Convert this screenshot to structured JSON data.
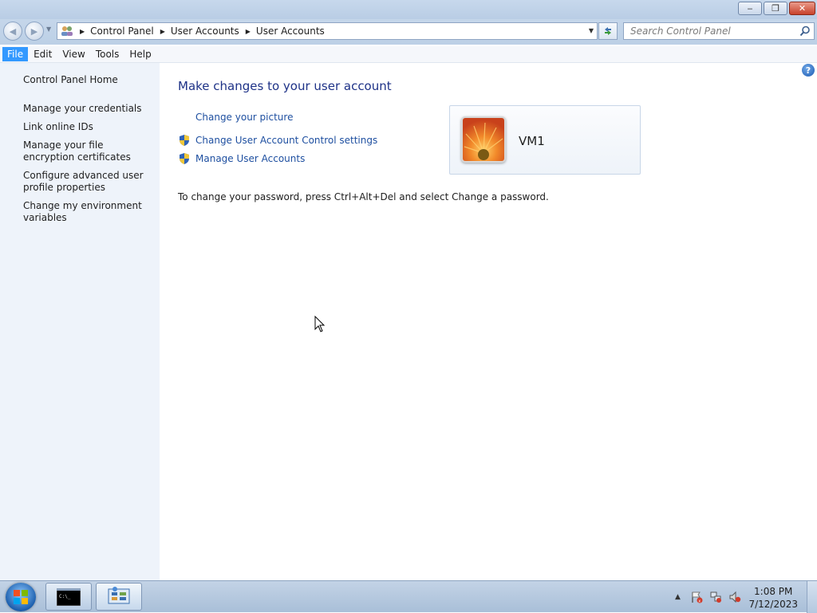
{
  "window": {
    "buttons": {
      "minimize": "‒",
      "restore": "❐",
      "close": "✕"
    }
  },
  "address": {
    "crumbs": [
      "Control Panel",
      "User Accounts",
      "User Accounts"
    ],
    "search_placeholder": "Search Control Panel"
  },
  "menu": {
    "items": [
      "File",
      "Edit",
      "View",
      "Tools",
      "Help"
    ],
    "active": "File"
  },
  "sidebar": {
    "home": "Control Panel Home",
    "links": [
      "Manage your credentials",
      "Link online IDs",
      "Manage your file encryption certificates",
      "Configure advanced user profile properties",
      "Change my environment variables"
    ]
  },
  "main": {
    "title": "Make changes to your user account",
    "tasks": [
      {
        "label": "Change your picture",
        "icon": "none"
      },
      {
        "label": "Change User Account Control settings",
        "icon": "shield-icon"
      },
      {
        "label": "Manage User Accounts",
        "icon": "shield-icon"
      }
    ],
    "user_name": "VM1",
    "password_note": "To change your password, press Ctrl+Alt+Del and select Change a password."
  },
  "taskbar": {
    "time": "1:08 PM",
    "date": "7/12/2023"
  },
  "colors": {
    "link": "#1e4fa0",
    "title": "#1e3287",
    "sidebar_bg": "#eef3fa",
    "menu_active": "#3399ff"
  }
}
